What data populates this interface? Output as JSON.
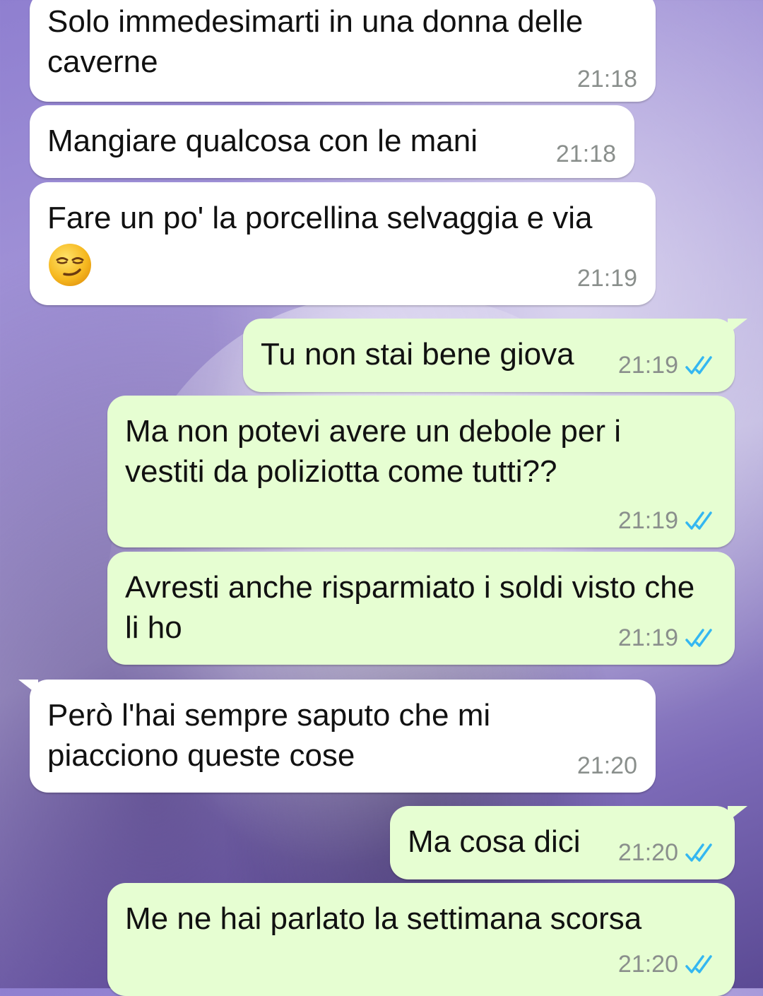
{
  "colors": {
    "incoming_bubble": "#ffffff",
    "outgoing_bubble": "#e6fed2",
    "timestamp": "#8a8f8c",
    "read_ticks": "#34b7f1"
  },
  "messages": [
    {
      "direction": "in",
      "text": "Solo immedesimarti in una donna delle caverne",
      "time": "21:18"
    },
    {
      "direction": "in",
      "text": "Mangiare qualcosa con le mani",
      "time": "21:18"
    },
    {
      "direction": "in",
      "text": "Fare un po' la porcellina selvaggia e via",
      "emoji": "smirking-face-emoji",
      "time": "21:19"
    },
    {
      "direction": "out",
      "text": "Tu non stai bene giova",
      "time": "21:19",
      "status": "read"
    },
    {
      "direction": "out",
      "text": "Ma non potevi avere un debole per i vestiti da poliziotta come tutti??",
      "time": "21:19",
      "status": "read"
    },
    {
      "direction": "out",
      "text": "Avresti anche risparmiato i soldi visto che li ho",
      "time": "21:19",
      "status": "read"
    },
    {
      "direction": "in",
      "text": "Però l'hai sempre saputo che mi piacciono queste cose",
      "time": "21:20"
    },
    {
      "direction": "out",
      "text": "Ma cosa dici",
      "time": "21:20",
      "status": "read"
    },
    {
      "direction": "out",
      "text": "Me ne hai parlato la settimana scorsa",
      "time": "21:20",
      "status": "read"
    }
  ]
}
